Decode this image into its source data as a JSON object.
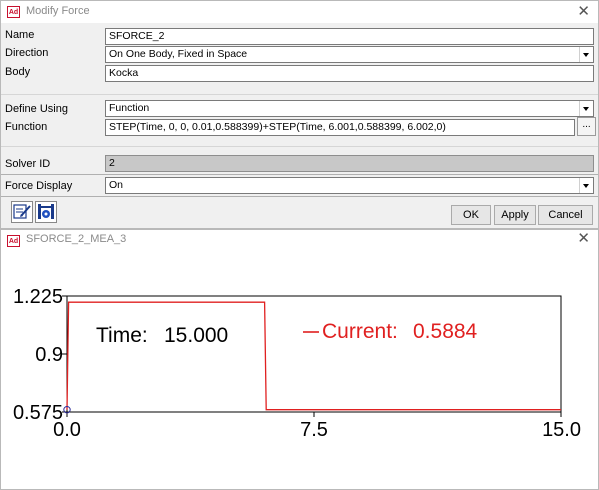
{
  "dialog": {
    "title": "Modify Force",
    "close_glyph": "✕",
    "app_icon_text": "Ad",
    "name_label": "Name",
    "name_value": "SFORCE_2",
    "direction_label": "Direction",
    "direction_value": "On One Body, Fixed in Space",
    "body_label": "Body",
    "body_value": "Kocka",
    "define_using_label": "Define Using",
    "define_using_value": "Function",
    "function_label": "Function",
    "function_value": "STEP(Time, 0, 0, 0.01,0.588399)+STEP(Time, 6.001,0.588399, 6.002,0)",
    "ellipsis_label": "...",
    "solver_id_label": "Solver ID",
    "solver_id_value": "2",
    "force_display_label": "Force Display",
    "force_display_value": "On",
    "ok_label": "OK",
    "apply_label": "Apply",
    "cancel_label": "Cancel",
    "tool_icons": [
      "edit-pencil-icon",
      "function-builder-icon"
    ]
  },
  "measure": {
    "title": "SFORCE_2_MEA_3",
    "app_icon_text": "Ad",
    "close_glyph": "✕",
    "time_label": "Time:",
    "time_value": "15.000",
    "legend_label": "Current:",
    "legend_value": "0.5884",
    "color": "#e02020"
  },
  "chart_data": {
    "type": "line",
    "x_ticks": [
      "0.0",
      "7.5",
      "15.0"
    ],
    "y_ticks": [
      "0.575",
      "0.9",
      "1.225"
    ],
    "xlim": [
      0,
      15
    ],
    "ylim": [
      0.575,
      1.225
    ],
    "series": [
      {
        "name": "Current",
        "color": "#e02020",
        "x": [
          0.0,
          0.05,
          6.0,
          6.05,
          15.0
        ],
        "y": [
          0.588,
          1.19,
          1.19,
          0.588,
          0.588
        ]
      }
    ],
    "grid": false
  }
}
